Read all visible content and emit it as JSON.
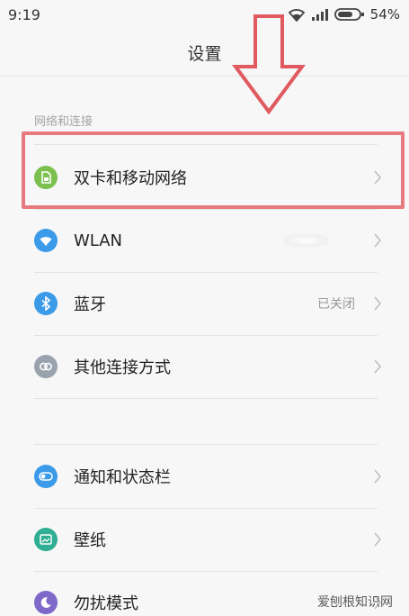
{
  "status_bar": {
    "time": "9:19",
    "battery": "54%"
  },
  "title": "设置",
  "section_header": "网络和连接",
  "rows": [
    {
      "label": "双卡和移动网络",
      "value": "",
      "icon": "sim-card-icon",
      "color": "#7cc04f"
    },
    {
      "label": "WLAN",
      "value": "",
      "icon": "wifi-icon",
      "color": "#3b9be8"
    },
    {
      "label": "蓝牙",
      "value": "已关闭",
      "icon": "bluetooth-icon",
      "color": "#3b9be8"
    },
    {
      "label": "其他连接方式",
      "value": "",
      "icon": "link-icon",
      "color": "#9aa3ad"
    },
    {
      "label": "通知和状态栏",
      "value": "",
      "icon": "toggle-icon",
      "color": "#3b9be8"
    },
    {
      "label": "壁纸",
      "value": "",
      "icon": "wallpaper-icon",
      "color": "#2fae93"
    },
    {
      "label": "勿扰模式",
      "value": "",
      "icon": "moon-icon",
      "color": "#7e68c9"
    }
  ],
  "annotation": {
    "highlight_color": "#e8797e",
    "arrow_color": "#e05a5f"
  },
  "watermark": "爱刨根知识网"
}
